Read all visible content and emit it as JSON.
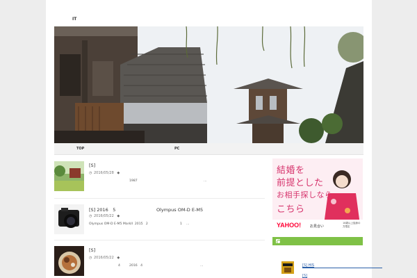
{
  "site": {
    "title": "IT"
  },
  "nav": {
    "items": [
      {
        "label": "TOP"
      },
      {
        "label": "PC"
      }
    ]
  },
  "posts": [
    {
      "title": "[S]",
      "date": "2016/05/28",
      "excerpt_parts": [
        "1987",
        "..."
      ]
    },
    {
      "title": "[S] 2016　5　　　　　　　　　Olympus OM-D E-M5",
      "date": "2016/05/22",
      "excerpt_parts": [
        "Olympus OM-D E-M5 MarkII  2015   2",
        "1",
        "..."
      ]
    },
    {
      "title": "[S]",
      "date": "2016/05/22",
      "excerpt_parts": [
        "4",
        "2016   4",
        "..."
      ]
    }
  ],
  "sidebar": {
    "ad": {
      "line1": "結婚を",
      "line2": "前提とした",
      "line3": "お相手探しなら",
      "line4": "こちら",
      "logo": "YAHOO!",
      "logo_sub": "お見合い",
      "small": "18歳以上独身の方限定"
    },
    "links": [
      {
        "label": "[S] HIS"
      },
      {
        "label": "[S]"
      }
    ]
  },
  "colors": {
    "accent_green": "#7fc146",
    "link_blue": "#2a5fa8",
    "ad_pink": "#d6336c"
  },
  "icons": {
    "date": "clock-icon",
    "tag": "tag-icon",
    "feed": "rss-icon"
  }
}
